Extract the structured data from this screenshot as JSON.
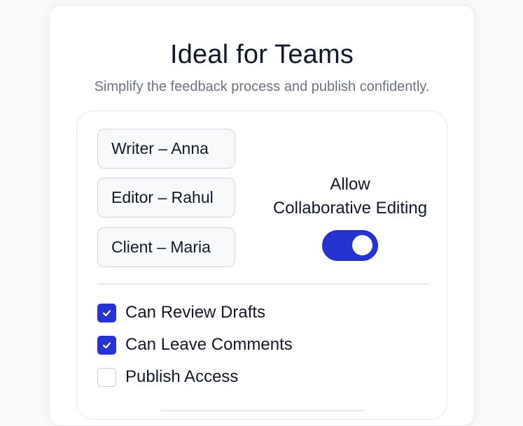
{
  "card": {
    "title": "Ideal for Teams",
    "subtitle": "Simplify the feedback process and publish confidently."
  },
  "roles": [
    {
      "label": "Writer – Anna"
    },
    {
      "label": "Editor – Rahul"
    },
    {
      "label": "Client – Maria"
    }
  ],
  "collaboration": {
    "label_line1": "Allow",
    "label_line2": "Collaborative Editing",
    "enabled": true
  },
  "permissions": [
    {
      "label": "Can Review Drafts",
      "checked": true,
      "icon": "check-icon"
    },
    {
      "label": "Can Leave Comments",
      "checked": true,
      "icon": "check-icon"
    },
    {
      "label": "Publish Access",
      "checked": false,
      "icon": ""
    }
  ],
  "colors": {
    "accent": "#2533d1",
    "text": "#111827",
    "muted": "#6b7280",
    "border": "#e5e7eb"
  }
}
